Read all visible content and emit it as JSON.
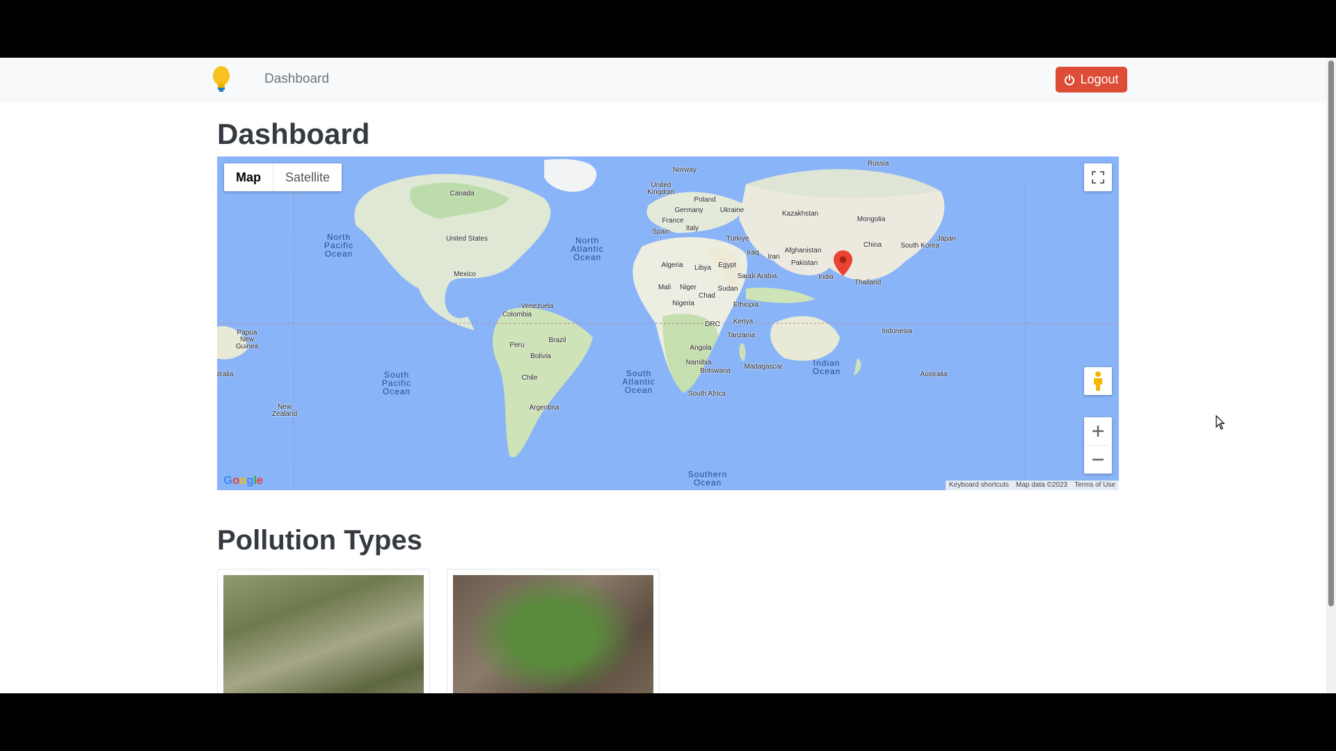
{
  "navbar": {
    "brand_icon": "lightbulb-icon",
    "nav_link": "Dashboard",
    "logout_label": "Logout",
    "logout_color": "#dc4c37"
  },
  "page": {
    "title": "Dashboard",
    "section_title": "Pollution Types"
  },
  "map": {
    "type_buttons": [
      "Map",
      "Satellite"
    ],
    "selected_type": "Map",
    "google_logo": "Google",
    "attribution": [
      "Keyboard shortcuts",
      "Map data ©2023",
      "Terms of Use"
    ],
    "labels": [
      "Russia",
      "Norway",
      "United Kingdom",
      "Poland",
      "Germany",
      "Ukraine",
      "France",
      "Spain",
      "Italy",
      "Türkiye",
      "Kazakhstan",
      "Mongolia",
      "Iraq",
      "Iran",
      "Afghanistan",
      "Pakistan",
      "China",
      "South Korea",
      "Japan",
      "Algeria",
      "Libya",
      "Egypt",
      "Saudi Arabia",
      "India",
      "Thailand",
      "Mali",
      "Niger",
      "Chad",
      "Sudan",
      "Nigeria",
      "Ethiopia",
      "DRC",
      "Kenya",
      "Tanzania",
      "Angola",
      "Namibia",
      "Botswana",
      "South Africa",
      "Madagascar",
      "Canada",
      "United States",
      "Mexico",
      "Venezuela",
      "Colombia",
      "Peru",
      "Brazil",
      "Bolivia",
      "Chile",
      "Argentina",
      "Papua New Guinea",
      "Indonesia",
      "Australia",
      "New Zealand",
      "stralia"
    ],
    "oceans": [
      "North Pacific Ocean",
      "North Atlantic Ocean",
      "South Pacific Ocean",
      "South Atlantic Ocean",
      "Indian Ocean",
      "Southern Ocean"
    ]
  },
  "cards": [
    {
      "image": "dry grass photo"
    },
    {
      "image": "plant on cracked soil photo"
    }
  ]
}
